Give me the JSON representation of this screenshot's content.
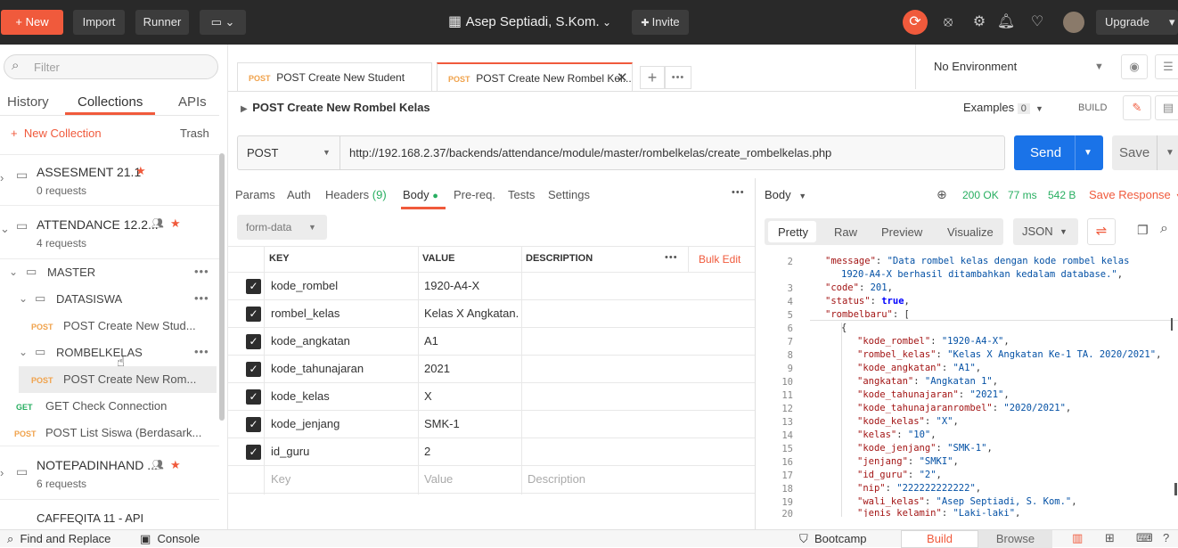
{
  "topbar": {
    "new_label": "New",
    "import_label": "Import",
    "runner_label": "Runner",
    "workspace_name": "Asep Septiadi, S.Kom.",
    "invite_label": "Invite",
    "upgrade_label": "Upgrade"
  },
  "sidebar": {
    "filter_placeholder": "Filter",
    "tabs": [
      "History",
      "Collections",
      "APIs"
    ],
    "new_collection_label": "New Collection",
    "trash_label": "Trash",
    "collections": [
      {
        "name": "ASSESMENT 21.1",
        "sub": "0 requests"
      },
      {
        "name": "ATTENDANCE 12.2...",
        "sub": "4 requests"
      },
      {
        "name": "NOTEPADINHAND ...",
        "sub": "6 requests"
      },
      {
        "name": "CAFFEQITA 11 - API",
        "sub": ""
      }
    ],
    "folders": [
      "MASTER",
      "DATASISWA",
      "ROMBELKELAS"
    ],
    "requests": [
      {
        "method": "POST",
        "name": "POST Create New Stud..."
      },
      {
        "method": "POST",
        "name": "POST Create New Rom..."
      },
      {
        "method": "GET",
        "name": "GET Check Connection"
      },
      {
        "method": "POST",
        "name": "POST List Siswa (Berdasark..."
      }
    ]
  },
  "tabs": [
    {
      "method": "POST",
      "title": "POST Create New Student"
    },
    {
      "method": "POST",
      "title": "POST Create New Rombel Kel..."
    }
  ],
  "environment": "No Environment",
  "request": {
    "title": "POST Create New Rombel Kelas",
    "examples_label": "Examples",
    "examples_count": "0",
    "build_label": "BUILD",
    "method": "POST",
    "url": "http://192.168.2.37/backends/attendance/module/master/rombelkelas/create_rombelkelas.php",
    "send_label": "Send",
    "save_label": "Save"
  },
  "req_tabs": [
    "Params",
    "Auth",
    "Headers",
    "(9)",
    "Body",
    "Pre-req.",
    "Tests",
    "Settings"
  ],
  "body_type": "form-data",
  "table": {
    "headers": [
      "KEY",
      "VALUE",
      "DESCRIPTION",
      "Bulk Edit"
    ],
    "rows": [
      {
        "key": "kode_rombel",
        "value": "1920-A4-X"
      },
      {
        "key": "rombel_kelas",
        "value": "Kelas X Angkatan..."
      },
      {
        "key": "kode_angkatan",
        "value": "A1"
      },
      {
        "key": "kode_tahunajaran",
        "value": "2021"
      },
      {
        "key": "kode_kelas",
        "value": "X"
      },
      {
        "key": "kode_jenjang",
        "value": "SMK-1"
      },
      {
        "key": "id_guru",
        "value": "2"
      }
    ],
    "placeholder_key": "Key",
    "placeholder_value": "Value",
    "placeholder_desc": "Description"
  },
  "response": {
    "body_label": "Body",
    "status": "200 OK",
    "time": "77 ms",
    "size": "542 B",
    "save_response": "Save Response",
    "view_tabs": [
      "Pretty",
      "Raw",
      "Preview",
      "Visualize"
    ],
    "format": "JSON"
  },
  "bottombar": {
    "find_replace": "Find and Replace",
    "console": "Console",
    "bootcamp": "Bootcamp",
    "build": "Build",
    "browse": "Browse"
  }
}
